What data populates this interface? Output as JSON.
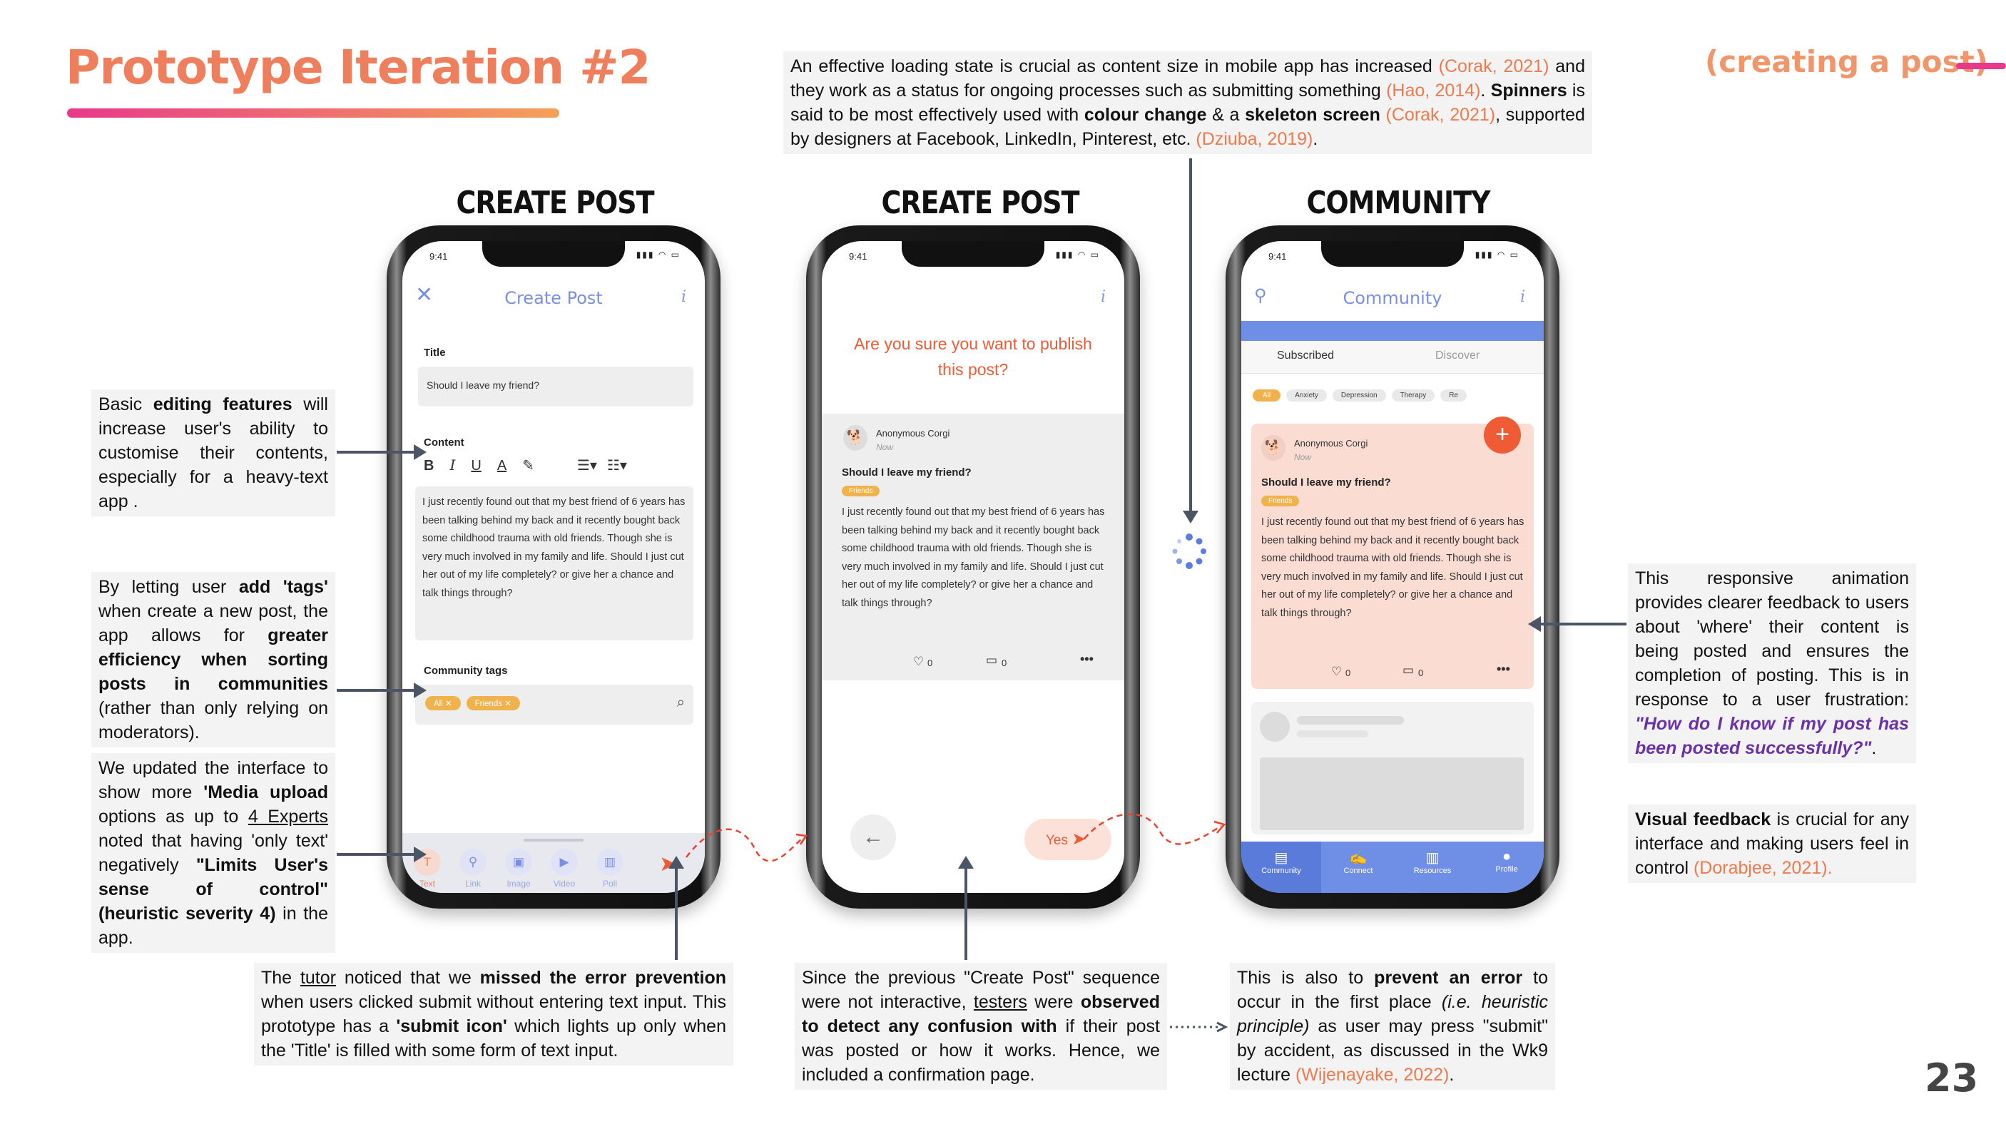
{
  "slide": {
    "title": "Prototype Iteration #2",
    "corner_tag": "(creating a post)",
    "page_number": "23"
  },
  "colors": {
    "accent_orange": "#ef7f5c",
    "accent_pink": "#e8398a",
    "citation": "#ee7a4e",
    "quote_purple": "#6b32a8",
    "app_blue": "#7b8fe0"
  },
  "phones": {
    "p1": {
      "heading": "CREATE POST",
      "time": "9:41",
      "app_title": "Create Post",
      "title_label": "Title",
      "title_value": "Should I leave my friend?",
      "content_label": "Content",
      "content_text": "I just recently found out that my best friend of 6 years has been talking behind my back and it recently bought back some childhood trauma with old friends. Though she is very much involved in my family and life. Should I just cut her out of my life completely? or give her a chance and talk things through?",
      "tags_label": "Community tags",
      "tags": [
        "All",
        "Friends"
      ],
      "toolbar": [
        "Text",
        "Link",
        "Image",
        "Video",
        "Poll"
      ]
    },
    "p2": {
      "heading": "CREATE POST",
      "time": "9:41",
      "confirm_question": "Are you sure you want to publish this post?",
      "author": "Anonymous Corgi",
      "posted": "Now",
      "post_title": "Should I leave my friend?",
      "tag": "Friends",
      "post_text": "I just recently found out that my best friend of 6 years has been talking behind my back and it recently bought back some childhood trauma with old friends. Though she is very much involved in my family and life. Should I just cut her out of my life completely? or give her a chance and talk things through?",
      "likes": "0",
      "comments": "0",
      "yes_label": "Yes"
    },
    "p3": {
      "heading": "COMMUNITY",
      "time": "9:41",
      "app_title": "Community",
      "tabs": [
        "Subscribed",
        "Discover"
      ],
      "filters": [
        "All",
        "Anxiety",
        "Depression",
        "Therapy",
        "Re"
      ],
      "author": "Anonymous Corgi",
      "posted": "Now",
      "post_title": "Should I leave my friend?",
      "tag": "Friends",
      "post_text": "I just recently found out that my best friend of 6 years has been talking behind my back and it recently bought back some childhood trauma with old friends. Though she is very much involved in my family and life. Should I just cut her out of my life completely? or give her a chance and talk things through?",
      "likes": "0",
      "comments": "0",
      "nav": [
        "Community",
        "Connect",
        "Resources",
        "Profile"
      ]
    }
  },
  "notes": {
    "loading_1": "An effective loading state is crucial as content size in mobile app has increased ",
    "loading_c1": "(Corak, 2021)",
    "loading_2": " and they work as a status for ongoing processes such as submitting something ",
    "loading_c2": "(Hao, 2014)",
    "loading_3": ". ",
    "loading_b1": "Spinners",
    "loading_4": " is said to be most effectively used with ",
    "loading_b2": "colour change",
    "loading_5": " & a ",
    "loading_b3": "skeleton screen",
    "loading_6": " ",
    "loading_c3": "(Corak, 2021)",
    "loading_7": ", supported by designers at Facebook, LinkedIn, Pinterest, etc. ",
    "loading_c4": "(Dziuba, 2019)",
    "loading_8": ".",
    "edit_1": "Basic ",
    "edit_b1": "editing features",
    "edit_2": " will increase user's ability to customise their contents, especially for a heavy-text app .",
    "tags_1": "By letting user ",
    "tags_b1": "add 'tags'",
    "tags_2": " when create a new post, the app allows for ",
    "tags_b2": "greater efficiency when sorting posts in communities",
    "tags_3": " (rather than only relying on moderators).",
    "media_1": "We updated the interface to show more ",
    "media_b1": "'Media upload",
    "media_2": " options as up to ",
    "media_u1": "4 Experts",
    "media_3": " noted that having 'only text' negatively ",
    "media_b2": "\"Limits User's sense of control\"",
    "media_b3": "(heuristic severity 4)",
    "media_4": " in the app.",
    "tutor_1": "The ",
    "tutor_u1": "tutor",
    "tutor_2": " noticed that we ",
    "tutor_b1": "missed the error prevention",
    "tutor_3": " when users clicked submit without entering text input. This prototype has a ",
    "tutor_b2": "'submit icon'",
    "tutor_4": " which lights up only when the 'Title' is filled with some form of text input.",
    "since_1": "Since the previous \"Create Post\" sequence were not interactive, ",
    "since_u1": "testers",
    "since_2": " were ",
    "since_b1": "observed to detect any confusion with",
    "since_3": " if their post was posted or how it works. Hence, we included a confirmation page.",
    "prevent_1": "This is also to ",
    "prevent_b1": "prevent an error",
    "prevent_2": " to occur in the first place ",
    "prevent_i1": "(i.e. heuristic principle)",
    "prevent_3": " as user may press \"submit\" by accident, as discussed in the Wk9 lecture ",
    "prevent_c1": "(Wijenayake, 2022)",
    "prevent_4": ".",
    "anim_1": "This responsive animation provides clearer feedback to users about 'where' their content is being posted and ensures the completion of posting. This is in response to a user frustration: ",
    "anim_q1": "\"How do I know if my post has been posted successfully?\"",
    "anim_2": ".",
    "visual_b1": "Visual feedback",
    "visual_1": " is crucial for any interface and making users feel in control ",
    "visual_c1": "(Dorabjee, 2021).",
    "visual_2": ""
  }
}
